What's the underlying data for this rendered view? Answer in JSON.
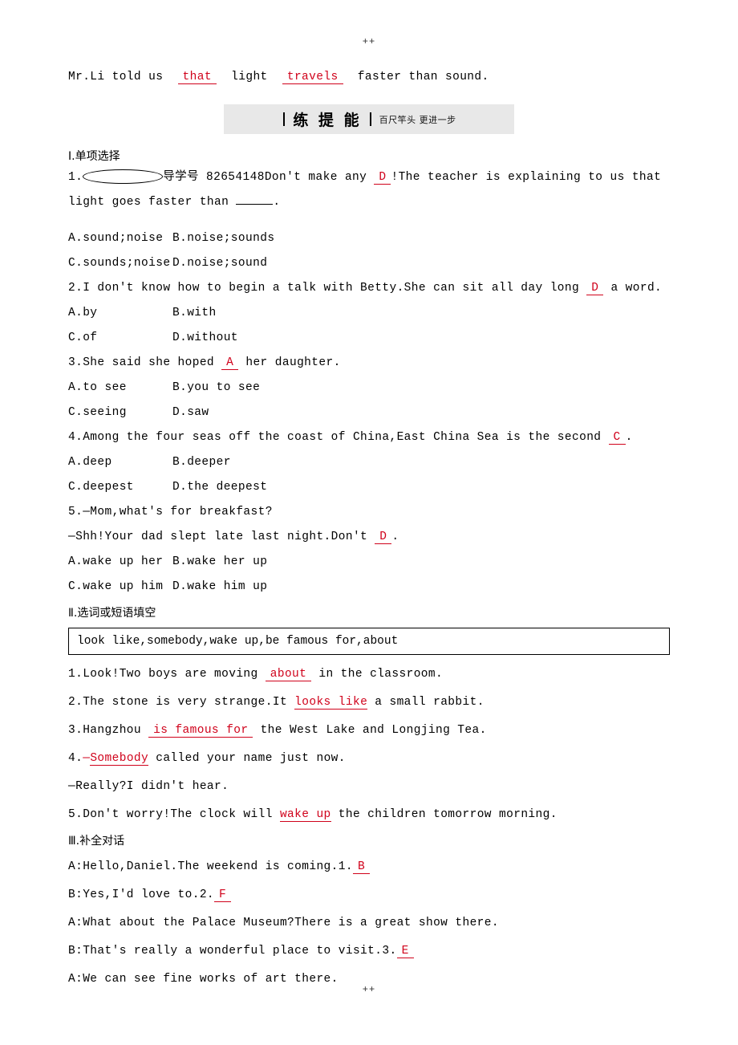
{
  "page": {
    "top_mark": "++",
    "bottom_mark": "++"
  },
  "intro_line": {
    "before": "Mr.Li told us",
    "answer1": "that",
    "mid": "light",
    "answer2": "travels",
    "after": "faster than sound."
  },
  "banner": {
    "title": "练 提 能",
    "subtitle": "百尺竿头  更进一步"
  },
  "section1": {
    "heading": "Ⅰ.单项选择",
    "questions": [
      {
        "num": "1.",
        "code": "导学号 82654148",
        "text_before": "Don't make any",
        "answer": "D",
        "text_after": "!The teacher is explaining to us that",
        "text_line2_before": "light goes faster than",
        "text_line2_after": ".",
        "options_row1": [
          "A.sound;noise",
          "B.noise;sounds"
        ],
        "options_row2": [
          "C.sounds;noise",
          "D.noise;sound"
        ]
      },
      {
        "num": "2.",
        "text_before": "I don't know how to begin a talk with Betty.She can sit all day long",
        "answer": "D",
        "text_after": "a word.",
        "options_row1": [
          "A.by",
          "B.with"
        ],
        "options_row2": [
          "C.of",
          "D.without"
        ]
      },
      {
        "num": "3.",
        "text_before": "She said she hoped",
        "answer": "A",
        "text_after": "her daughter.",
        "options_row1": [
          "A.to see",
          "B.you to see"
        ],
        "options_row2": [
          "C.seeing",
          "D.saw"
        ]
      },
      {
        "num": "4.",
        "text_before": "Among the four seas off the coast of China,East China Sea is the second",
        "answer": "C",
        "text_after": ".",
        "options_row1": [
          "A.deep",
          "B.deeper"
        ],
        "options_row2": [
          "C.deepest",
          "D.the deepest"
        ]
      },
      {
        "num": "5.",
        "dialog_a": "—Mom,what's for breakfast?",
        "dialog_b_before": "—Shh!Your dad slept late last night.Don't",
        "answer": "D",
        "dialog_b_after": ".",
        "options_row1": [
          "A.wake up her",
          "B.wake her up"
        ],
        "options_row2": [
          "C.wake up him",
          "D.wake him up"
        ]
      }
    ]
  },
  "section2": {
    "heading": "Ⅱ.选词或短语填空",
    "wordbank": "look like,somebody,wake up,be famous for,about",
    "items": [
      {
        "num": "1.",
        "before": "Look!Two boys are moving",
        "answer": "about",
        "after": "in the classroom."
      },
      {
        "num": "2.",
        "before": "The stone is very strange.It",
        "answer": "looks like",
        "after": "a small rabbit."
      },
      {
        "num": "3.",
        "before": "Hangzhou",
        "answer": "is famous for",
        "after": "the West Lake and Longjing Tea."
      },
      {
        "num": "4.",
        "before": "—",
        "answer": "Somebody",
        "after": "called your name just now.",
        "reply": "—Really?I didn't hear."
      },
      {
        "num": "5.",
        "before": "Don't worry!The clock will",
        "answer": "wake up",
        "after": "the children tomorrow morning."
      }
    ]
  },
  "section3": {
    "heading": "Ⅲ.补全对话",
    "lines": [
      {
        "before": "A:Hello,Daniel.The weekend is coming.1.",
        "answer": "B",
        "after": ""
      },
      {
        "before": "B:Yes,I'd love to.2.",
        "answer": "F",
        "after": ""
      },
      {
        "before": "A:What about the Palace Museum?There is a great show there.",
        "answer": "",
        "after": ""
      },
      {
        "before": "B:That's really a wonderful place to visit.3.",
        "answer": "E",
        "after": ""
      },
      {
        "before": "A:We can see fine works of art there.",
        "answer": "",
        "after": ""
      }
    ]
  },
  "colors": {
    "answer_red": "#d0021b",
    "banner_bg": "#e8e8e8"
  }
}
